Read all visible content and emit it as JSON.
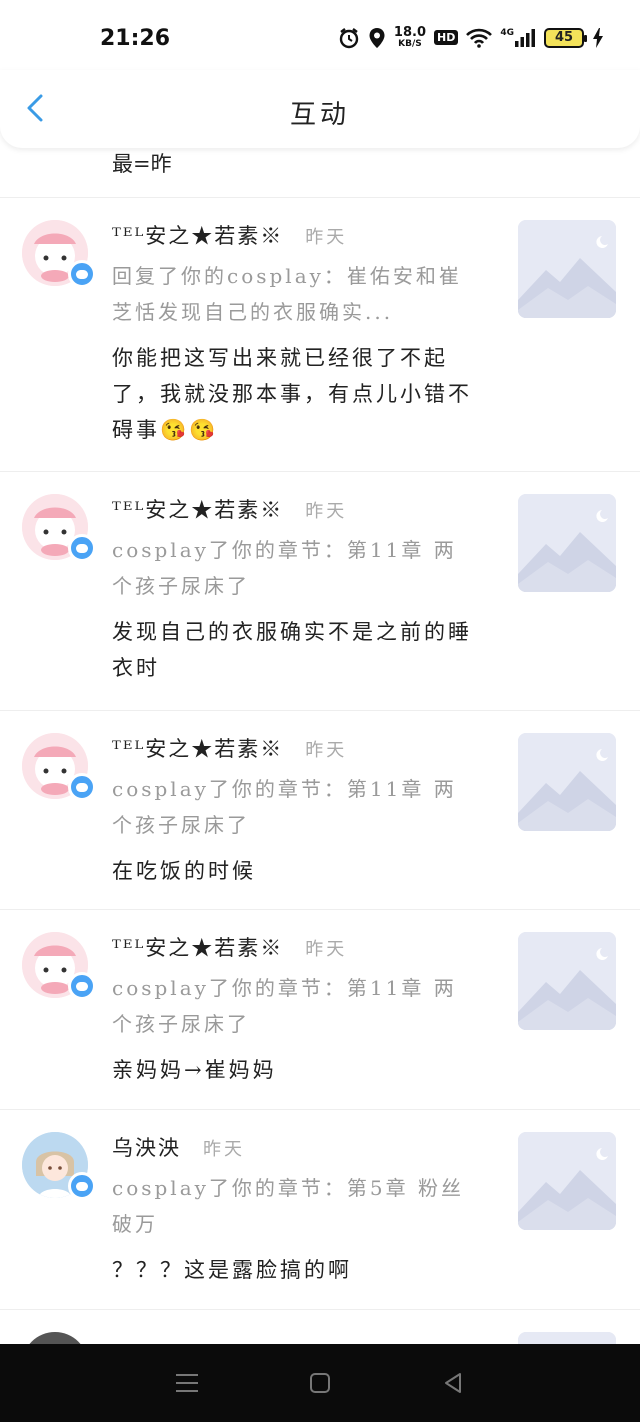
{
  "status_bar": {
    "time": "21:26",
    "net_speed_value": "18.0",
    "net_speed_unit": "KB/S",
    "hd": "HD",
    "network": "4G",
    "battery": "45"
  },
  "header": {
    "title": "互动"
  },
  "partial_item": {
    "text": "最=昨"
  },
  "items": [
    {
      "username": "ᵀᴱᴸ安之★若素※",
      "time": "昨天",
      "reference": "回复了你的cosplay：崔佑安和崔芝恬发现自己的衣服确实...",
      "comment": "你能把这写出来就已经很了不起了，我就没那本事，有点儿小错不碍事😘😘"
    },
    {
      "username": "ᵀᴱᴸ安之★若素※",
      "time": "昨天",
      "reference": "cosplay了你的章节：第11章 两个孩子尿床了",
      "comment": "发现自己的衣服确实不是之前的睡衣时"
    },
    {
      "username": "ᵀᴱᴸ安之★若素※",
      "time": "昨天",
      "reference": "cosplay了你的章节：第11章 两个孩子尿床了",
      "comment": "在吃饭的时候"
    },
    {
      "username": "ᵀᴱᴸ安之★若素※",
      "time": "昨天",
      "reference": "cosplay了你的章节：第11章 两个孩子尿床了",
      "comment": "亲妈妈→崔妈妈"
    },
    {
      "username": "乌泱泱",
      "time": "昨天",
      "reference": "cosplay了你的章节：第5章 粉丝破万",
      "comment": "？？？这是露脸搞的啊"
    }
  ],
  "colors": {
    "accent": "#3a9be6",
    "badge": "#4aa3f5",
    "muted_text": "#9a9a9a"
  }
}
